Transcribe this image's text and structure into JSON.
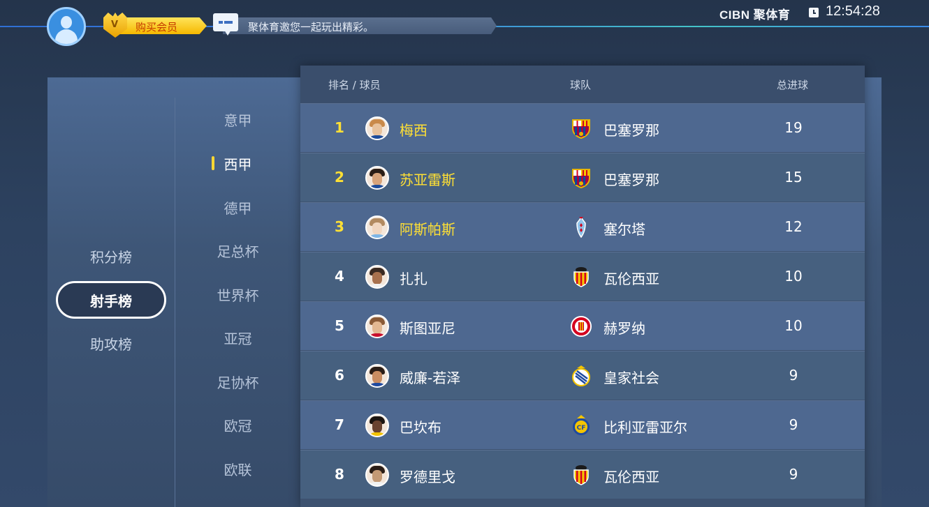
{
  "header": {
    "vip_label": "购买会员",
    "vip_badge": "V",
    "message": "聚体育邀您一起玩出精彩。",
    "brand": "CIBN 聚体育",
    "time": "12:54:28"
  },
  "categories": [
    {
      "label": "积分榜",
      "active": false
    },
    {
      "label": "射手榜",
      "active": true
    },
    {
      "label": "助攻榜",
      "active": false
    }
  ],
  "leagues": [
    {
      "label": "意甲",
      "active": false
    },
    {
      "label": "西甲",
      "active": true
    },
    {
      "label": "德甲",
      "active": false
    },
    {
      "label": "足总杯",
      "active": false
    },
    {
      "label": "世界杯",
      "active": false
    },
    {
      "label": "亚冠",
      "active": false
    },
    {
      "label": "足协杯",
      "active": false
    },
    {
      "label": "欧冠",
      "active": false
    },
    {
      "label": "欧联",
      "active": false
    }
  ],
  "table": {
    "col_rank_player": "排名 / 球员",
    "col_team": "球队",
    "col_goals": "总进球",
    "rows": [
      {
        "rank": "1",
        "player": "梅西",
        "team": "巴塞罗那",
        "goals": "19",
        "crest": "barcelona-crest-icon"
      },
      {
        "rank": "2",
        "player": "苏亚雷斯",
        "team": "巴塞罗那",
        "goals": "15",
        "crest": "barcelona-crest-icon"
      },
      {
        "rank": "3",
        "player": "阿斯帕斯",
        "team": "塞尔塔",
        "goals": "12",
        "crest": "celta-crest-icon"
      },
      {
        "rank": "4",
        "player": "扎扎",
        "team": "瓦伦西亚",
        "goals": "10",
        "crest": "valencia-crest-icon"
      },
      {
        "rank": "5",
        "player": "斯图亚尼",
        "team": "赫罗纳",
        "goals": "10",
        "crest": "girona-crest-icon"
      },
      {
        "rank": "6",
        "player": "威廉-若泽",
        "team": "皇家社会",
        "goals": "9",
        "crest": "real-sociedad-crest-icon"
      },
      {
        "rank": "7",
        "player": "巴坎布",
        "team": "比利亚雷亚尔",
        "goals": "9",
        "crest": "villarreal-crest-icon"
      },
      {
        "rank": "8",
        "player": "罗德里戈",
        "team": "瓦伦西亚",
        "goals": "9",
        "crest": "valencia-crest-icon"
      }
    ]
  },
  "colors": {
    "highlight_yellow": "#ffe034",
    "accent_blue": "#3a7de0"
  }
}
